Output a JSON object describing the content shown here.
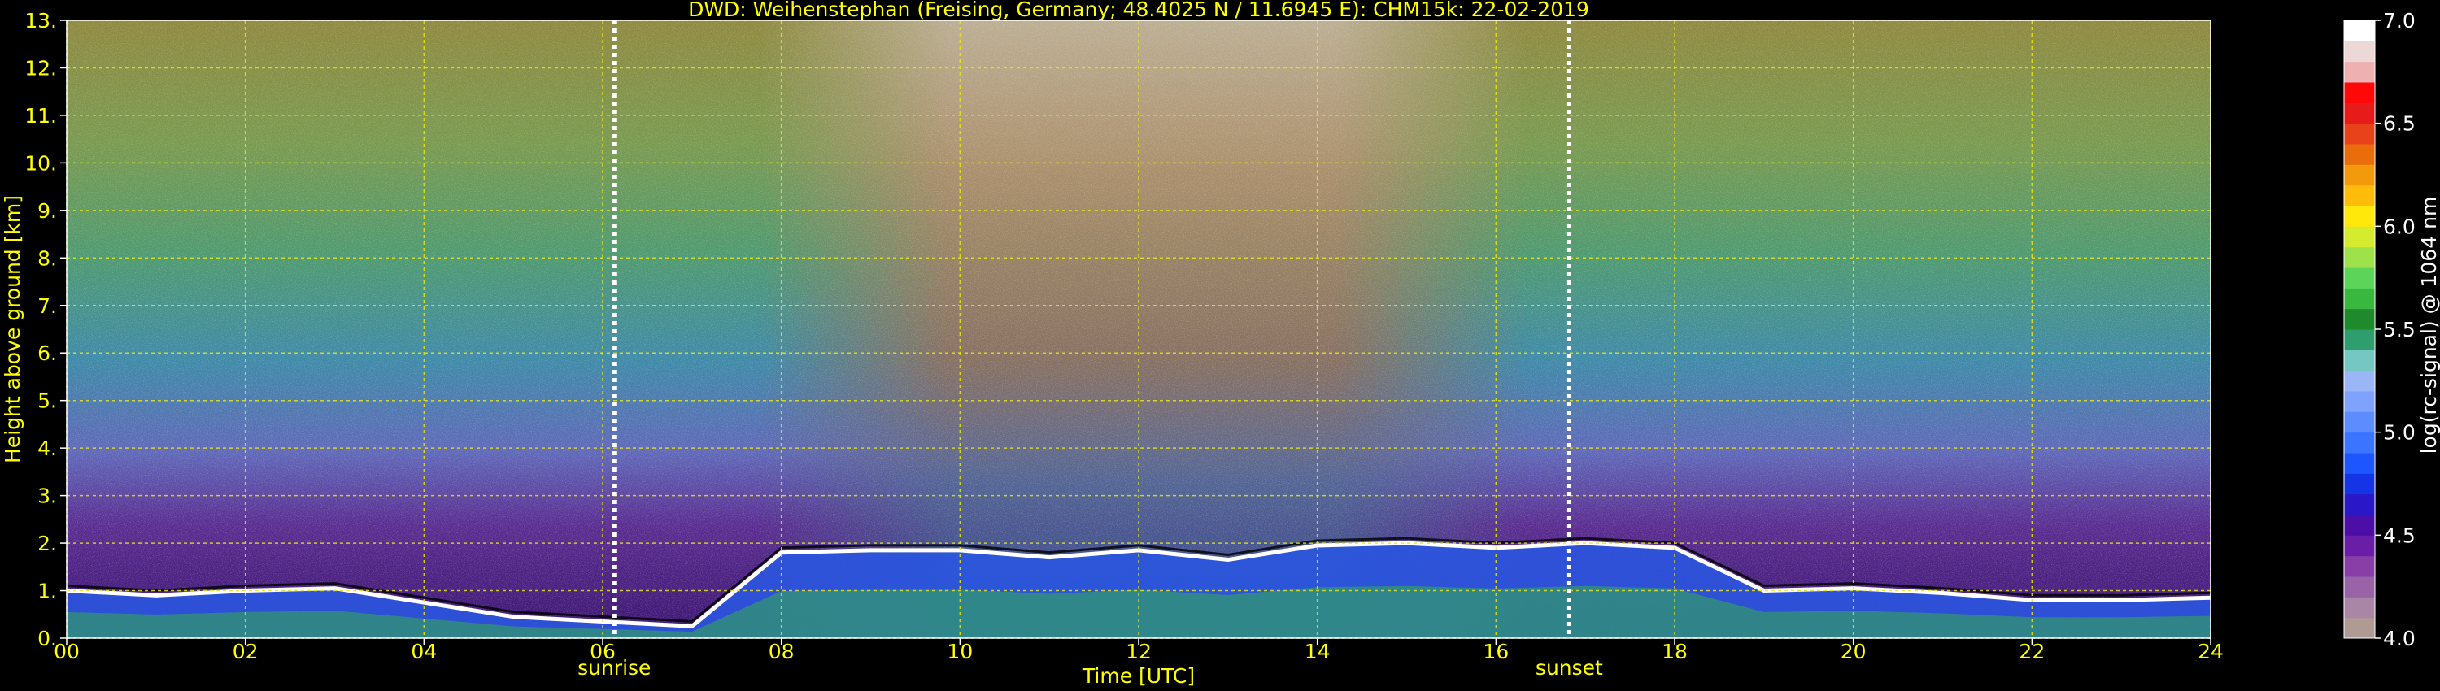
{
  "chart_data": [
    {
      "type": "heatmap",
      "title": "DWD: Weihenstephan (Freising, Germany; 48.4025 N / 11.6945 E):    CHM15k: 22-02-2019",
      "xlabel": "Time [UTC]",
      "ylabel": "Height above ground [km]",
      "xlim": [
        0,
        24
      ],
      "ylim": [
        0,
        13
      ],
      "x_ticks": [
        "00",
        "02",
        "04",
        "06",
        "08",
        "10",
        "12",
        "14",
        "16",
        "18",
        "20",
        "22",
        "24"
      ],
      "y_ticks": [
        "0.",
        "1.",
        "2.",
        "3.",
        "4.",
        "5.",
        "6.",
        "7.",
        "8.",
        "9.",
        "10.",
        "11.",
        "12.",
        "13."
      ],
      "grid": true,
      "markers": [
        {
          "label": "sunrise",
          "time_utc": 6.13
        },
        {
          "label": "sunset",
          "time_utc": 16.82
        }
      ],
      "boundary_layer_top_km": {
        "time_utc": [
          0,
          1,
          2,
          3,
          4,
          5,
          6,
          7,
          8,
          9,
          10,
          11,
          12,
          13,
          14,
          15,
          16,
          17,
          18,
          19,
          20,
          21,
          22,
          23,
          24
        ],
        "height": [
          1.0,
          0.9,
          1.0,
          1.05,
          0.75,
          0.45,
          0.35,
          0.25,
          1.8,
          1.85,
          1.85,
          1.7,
          1.85,
          1.65,
          1.95,
          2.0,
          1.9,
          2.0,
          1.9,
          1.0,
          1.05,
          0.95,
          0.8,
          0.8,
          0.85
        ]
      },
      "colorbar": {
        "label": "log(rc-signal) @ 1064 nm",
        "range": [
          4.0,
          7.0
        ],
        "ticks": [
          "4.0",
          "4.5",
          "5.0",
          "5.5",
          "6.0",
          "6.5",
          "7.0"
        ],
        "tick_values": [
          4.0,
          4.5,
          5.0,
          5.5,
          6.0,
          6.5,
          7.0
        ],
        "colors": [
          "#b09a94",
          "#a986a6",
          "#9a63a8",
          "#883ea6",
          "#6a1da6",
          "#4b0fa8",
          "#2a18c8",
          "#1534e6",
          "#1d55ff",
          "#3a74ff",
          "#5d8cff",
          "#7fa2ff",
          "#9ab6f6",
          "#74c7c2",
          "#2e9e6e",
          "#1e8a2c",
          "#38b83f",
          "#5cd45a",
          "#9ee24b",
          "#d5ec2e",
          "#ffe80a",
          "#ffbc0a",
          "#f29a0b",
          "#ea6d0c",
          "#e8421a",
          "#e81b1b",
          "#ff0808",
          "#eeb0b0",
          "#ecd8d6",
          "#ffffff"
        ]
      }
    }
  ],
  "colors": {
    "background": "#000000",
    "axis_text": "#ffff00",
    "colorbar_text": "#ffffff",
    "grid": "#e6e61a",
    "marker_line": "#ffffff"
  }
}
